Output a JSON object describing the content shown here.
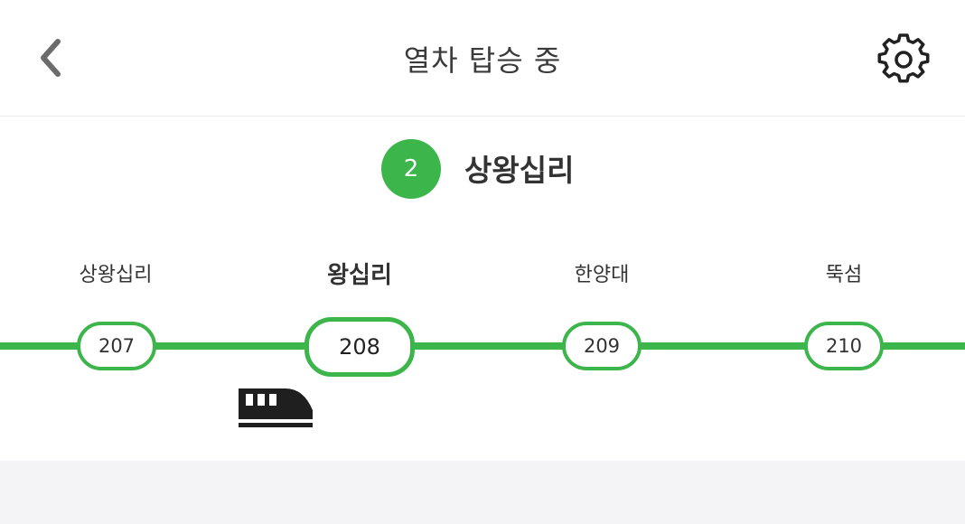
{
  "header": {
    "title": "열차 탑승 중",
    "back_icon": "chevron-left-icon",
    "settings_icon": "gear-icon"
  },
  "line": {
    "number": "2",
    "color": "#3cb54a",
    "current_station": "상왕십리"
  },
  "stations": [
    {
      "name": "상왕십리",
      "code": "207",
      "active": false
    },
    {
      "name": "왕십리",
      "code": "208",
      "active": true
    },
    {
      "name": "한양대",
      "code": "209",
      "active": false
    },
    {
      "name": "뚝섬",
      "code": "210",
      "active": false
    }
  ],
  "train": {
    "icon": "train-icon"
  },
  "colors": {
    "line_green": "#3cb54a",
    "text_dark": "#333333",
    "bottom_bg": "#f4f4f6"
  }
}
